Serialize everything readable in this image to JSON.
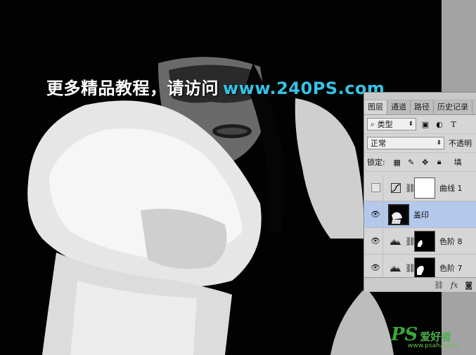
{
  "watermark": {
    "text": "更多精品教程，请访问",
    "url": "www.240PS.com"
  },
  "layers_panel": {
    "tabs": [
      {
        "label": "图层",
        "active": true
      },
      {
        "label": "通道",
        "active": false
      },
      {
        "label": "路径",
        "active": false
      },
      {
        "label": "历史记录",
        "active": false
      }
    ],
    "filter_kind": "类型",
    "filter_icon": "search-icon",
    "blend_mode": "正常",
    "opacity_label": "不透明",
    "lock_label": "锁定:",
    "fill_label": "填",
    "layers": [
      {
        "name": "曲线 1",
        "visible": false,
        "type": "curves",
        "mask": "white",
        "selected": false
      },
      {
        "name": "盖印",
        "visible": true,
        "type": "pixel",
        "mask": "photo",
        "selected": true
      },
      {
        "name": "色阶 8",
        "visible": true,
        "type": "levels",
        "mask": "black",
        "selected": false
      },
      {
        "name": "色阶 7",
        "visible": true,
        "type": "levels",
        "mask": "black",
        "selected": false
      }
    ],
    "accent_color": "#b4c8ec"
  },
  "logo": {
    "ps": "PS",
    "cn": "爱好者",
    "url": "www.psahz.com"
  }
}
